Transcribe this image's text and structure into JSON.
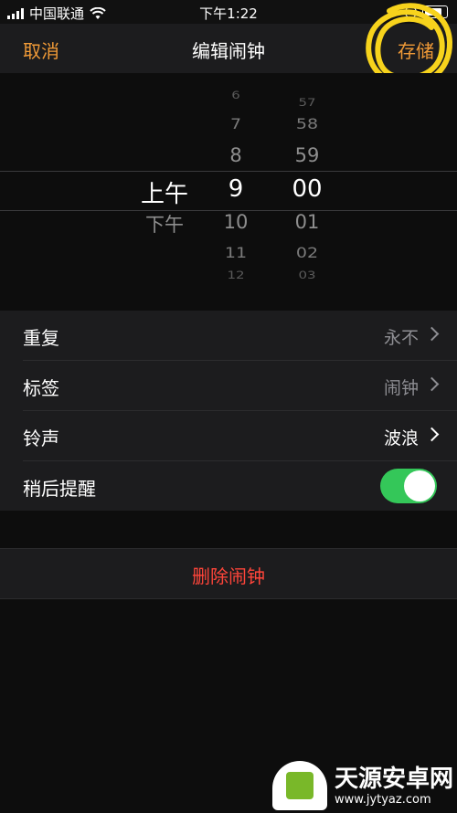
{
  "status_bar": {
    "carrier": "中国联通",
    "time": "下午1:22"
  },
  "navbar": {
    "cancel_label": "取消",
    "title": "编辑闹钟",
    "save_label": "存储"
  },
  "picker": {
    "ampm": {
      "selected": "上午",
      "below": "下午"
    },
    "hours": {
      "above": [
        "6",
        "7",
        "8"
      ],
      "selected": "9",
      "below": [
        "10",
        "11",
        "12"
      ]
    },
    "minutes": {
      "above": [
        "57",
        "58",
        "59"
      ],
      "selected": "00",
      "below": [
        "01",
        "02",
        "03"
      ]
    }
  },
  "settings": [
    {
      "label": "重复",
      "value": "永不"
    },
    {
      "label": "标签",
      "value": "闹钟"
    },
    {
      "label": "铃声",
      "value": "波浪"
    },
    {
      "label": "稍后提醒",
      "toggle": true
    }
  ],
  "delete_label": "删除闹钟",
  "watermark": {
    "title": "天源安卓网",
    "url": "www.jytyaz.com"
  },
  "colors": {
    "accent": "#f09a37",
    "destructive": "#ff453a",
    "toggle_on": "#34c759"
  }
}
